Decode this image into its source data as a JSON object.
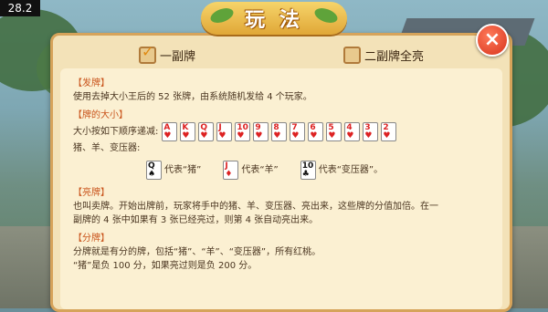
{
  "version": "28.2",
  "title": "玩 法",
  "close_icon": "close-icon",
  "options": [
    {
      "label": "一副牌",
      "checked": true
    },
    {
      "label": "二副牌全亮",
      "checked": false
    }
  ],
  "sections": {
    "deal": {
      "header": "【发牌】",
      "text": "使用去掉大小王后的 52 张牌，由系统随机发给 4 个玩家。"
    },
    "rank": {
      "header": "【牌的大小】",
      "intro": "大小按如下顺序递减:",
      "cards": [
        {
          "rank": "A",
          "suit": "♥"
        },
        {
          "rank": "K",
          "suit": "♥"
        },
        {
          "rank": "Q",
          "suit": "♥"
        },
        {
          "rank": "J",
          "suit": "♥"
        },
        {
          "rank": "10",
          "suit": "♥"
        },
        {
          "rank": "9",
          "suit": "♥"
        },
        {
          "rank": "8",
          "suit": "♥"
        },
        {
          "rank": "7",
          "suit": "♥"
        },
        {
          "rank": "6",
          "suit": "♥"
        },
        {
          "rank": "5",
          "suit": "♥"
        },
        {
          "rank": "4",
          "suit": "♥"
        },
        {
          "rank": "3",
          "suit": "♥"
        },
        {
          "rank": "2",
          "suit": "♥"
        }
      ],
      "special_line": "猪、羊、变压器:",
      "special": [
        {
          "rank": "Q",
          "suit": "♠",
          "text": "代表“猪”"
        },
        {
          "rank": "J",
          "suit": "♦",
          "text": "代表“羊”"
        },
        {
          "rank": "10",
          "suit": "♣",
          "text": "代表“变压器”。"
        }
      ]
    },
    "reveal": {
      "header": "【亮牌】",
      "line1": "也叫卖牌。开始出牌前，玩家将手中的猪、羊、变压器、亮出来，这些牌的分值加倍。在一",
      "line2": "副牌的 4 张中如果有 3 张已经亮过，则第 4 张自动亮出来。"
    },
    "score": {
      "header": "【分牌】",
      "line1": "分牌就是有分的牌，包括“猪”、“羊”、“变压器”，所有红桃。",
      "line2": "“猪”是负 100 分，如果亮过则是负 200 分。"
    }
  },
  "colors": {
    "accent": "#c9541c",
    "panel": "#f3e2b8",
    "close": "#d7341d"
  }
}
